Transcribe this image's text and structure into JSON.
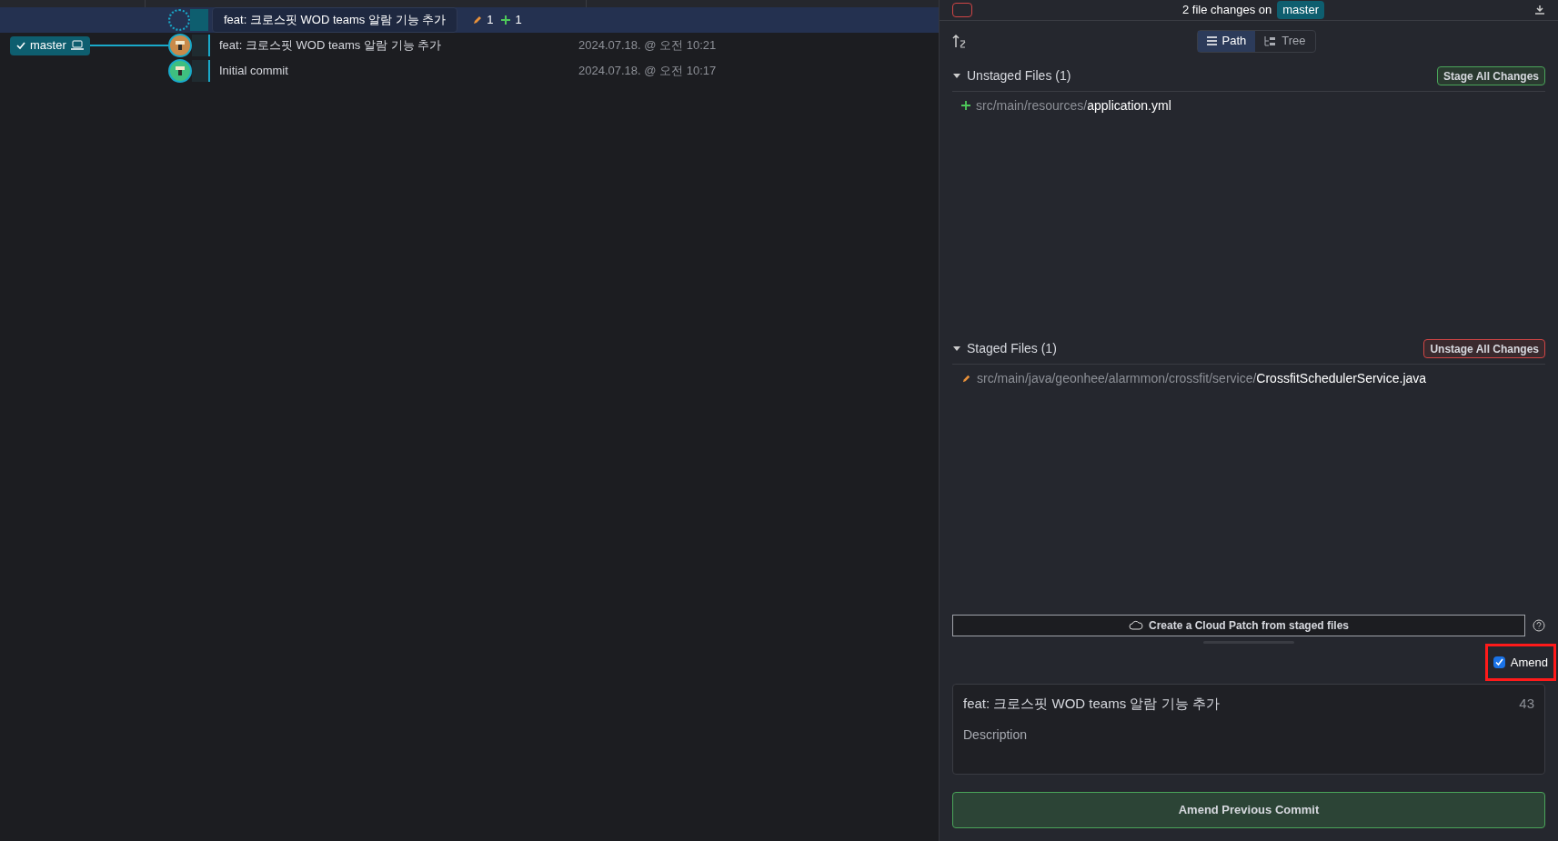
{
  "branch": {
    "name": "master",
    "checked": true
  },
  "commits": [
    {
      "kind": "wip",
      "message": "feat: 크로스핏 WOD teams 알람 기능 추가",
      "edits": "1",
      "adds": "1",
      "selected": true
    },
    {
      "kind": "commit",
      "message": "feat: 크로스핏 WOD teams 알람 기능 추가",
      "date": "2024.07.18. @ 오전 10:21",
      "selected": false
    },
    {
      "kind": "commit",
      "message": "Initial commit",
      "date": "2024.07.18. @ 오전 10:17",
      "selected": false
    }
  ],
  "header": {
    "text": "2 file changes on",
    "branch": "master"
  },
  "view_toggle": [
    {
      "label": "Path",
      "selected": true
    },
    {
      "label": "Tree",
      "selected": false
    }
  ],
  "sections": [
    {
      "kind": "unstaged",
      "title": "Unstaged Files (1)",
      "button": "Stage All Changes",
      "expanded": true,
      "files": [
        {
          "kind": "added",
          "dir": "src/main/resources/",
          "name": "application.yml"
        }
      ]
    },
    {
      "kind": "staged",
      "title": "Staged Files (1)",
      "button": "Unstage All Changes",
      "expanded": true,
      "files": [
        {
          "kind": "modified",
          "dir": "src/main/java/geonhee/alarmmon/crossfit/service/",
          "name": "CrossfitSchedulerService.java"
        }
      ]
    }
  ],
  "cloud_patch_button": "Create a Cloud Patch from staged files",
  "amend": {
    "label": "Amend",
    "checked": true
  },
  "commit_message": {
    "summary": "feat: 크로스핏 WOD teams 알람 기능 추가",
    "char_count": "43",
    "placeholder": "Description"
  },
  "commit_button": "Amend Previous Commit"
}
